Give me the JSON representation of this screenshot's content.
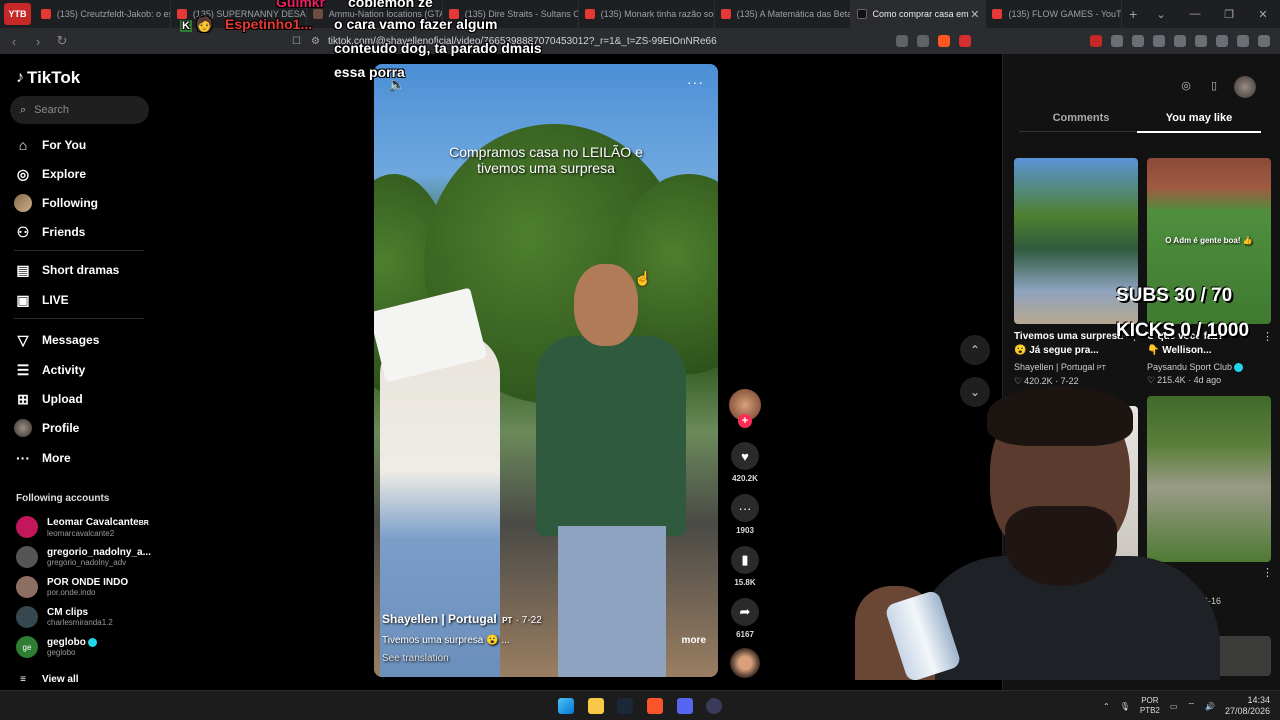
{
  "browser": {
    "profile_badge": "YTB",
    "tabs": [
      {
        "title": "(135) Creutzfeldt-Jakob: o es"
      },
      {
        "title": "(135) SUPERNANNY DESABA"
      },
      {
        "title": "Ammu-Nation locations (GTA"
      },
      {
        "title": "(135) Dire Straits - Sultans Of"
      },
      {
        "title": "(135) Monark tinha razão sob"
      },
      {
        "title": "(135) A Matemática das Beta"
      },
      {
        "title": "Como comprar casa em"
      },
      {
        "title": "(135) FLOW GAMES - YouTub"
      }
    ],
    "url": "tiktok.com/@shayellenoficial/video/7665398887070453012?_r=1&_t=ZS-99EIOnNRe66"
  },
  "chat_overlay": {
    "user1": "Espetinho1...",
    "message1_line1": "o cara vamo fazer algum",
    "message1_line2": "conteudo dog, ta parado dmais",
    "message1_line3": "essa porra",
    "user0": "Guimkr",
    "user0_msg": "coblemon ze"
  },
  "sidebar": {
    "logo": "TikTok",
    "search_placeholder": "Search",
    "nav": {
      "for_you": "For You",
      "explore": "Explore",
      "following": "Following",
      "friends": "Friends",
      "short_dramas": "Short dramas",
      "live": "LIVE",
      "messages": "Messages",
      "activity": "Activity",
      "upload": "Upload",
      "profile": "Profile",
      "more": "More"
    },
    "following_title": "Following accounts",
    "accounts": [
      {
        "name": "Leomar Cavalcante",
        "suffix": "BR",
        "handle": "leomarcavalcante2",
        "color": "#c2185b"
      },
      {
        "name": "gregorio_nadolny_a...",
        "suffix": "",
        "handle": "gregorio_nadolny_adv",
        "color": "#555555"
      },
      {
        "name": "POR ONDE INDO",
        "suffix": "",
        "handle": "por.onde.indo",
        "color": "#8d6e63"
      },
      {
        "name": "CM clips",
        "suffix": "",
        "handle": "charlesmiranda1.2",
        "color": "#37474f"
      },
      {
        "name": "geglobo",
        "suffix": "",
        "handle": "geglobo",
        "color": "#2e7d32"
      }
    ],
    "view_all": "View all"
  },
  "video": {
    "caption_line1": "Compramos casa no LEILÃO e",
    "caption_line2": "tivemos uma surpresa",
    "author": "Shayellen | Portugal",
    "author_tag": "PT",
    "date": "· 7-22",
    "description": "Tivemos uma surpresa 😮 ...",
    "more_label": "more",
    "see_translation": "See translation"
  },
  "actions": {
    "likes": "420.2K",
    "comments": "1903",
    "saves": "15.8K",
    "shares": "6167"
  },
  "right_panel": {
    "tab_comments": "Comments",
    "tab_you_may_like": "You may like",
    "recs": [
      {
        "title": "Tivemos uma surpresa",
        "title2": "😮 Já segue pra...",
        "author": "Shayellen | Portugal",
        "author_tag": "PT",
        "likes": "420.2K",
        "date": "7-22",
        "thumb_caption": ""
      },
      {
        "title": "O que você faz?",
        "title2": "👇 Wellison...",
        "author": "Paysandu Sport Club",
        "author_tag": "",
        "likes": "215.4K",
        "date": "4d ago",
        "thumb_caption": "O Adm é gente boa! 👍"
      },
      {
        "title": "",
        "title2": "",
        "author": "",
        "author_tag": "",
        "likes": "",
        "date": "",
        "thumb_caption": ""
      },
      {
        "title": "",
        "title2": "",
        "author": "",
        "author_tag": "",
        "likes": "",
        "date": "6-16",
        "thumb_caption": ""
      }
    ]
  },
  "stream_overlay": {
    "subs": "SUBS 30 / 70",
    "kicks": "KICKS 0 / 1000"
  },
  "taskbar": {
    "lang_line1": "POR",
    "lang_line2": "PTB2",
    "time": "14:34",
    "date": "27/08/2026"
  }
}
